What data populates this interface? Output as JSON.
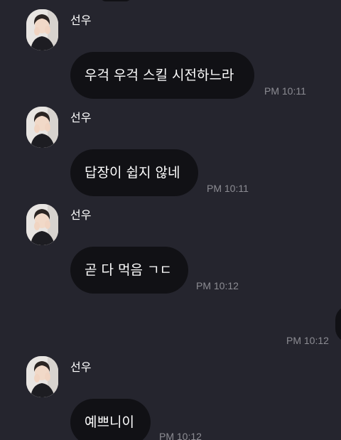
{
  "messages": [
    {
      "sender": "선우",
      "text": "우걱 우걱 스킬 시전하느라",
      "time": "PM 10:11"
    },
    {
      "sender": "선우",
      "text": "답장이 쉽지 않네",
      "time": "PM 10:11"
    },
    {
      "sender": "선우",
      "text": "곧 다 먹음 ㄱㄷ",
      "time": "PM 10:12"
    },
    {
      "sender": "선우",
      "text": "예쁘니이",
      "time": "PM 10:12"
    }
  ],
  "outgoing": {
    "time": "PM 10:12"
  },
  "colors": {
    "background": "#25252e",
    "bubble": "#111115",
    "text": "#ffffff",
    "timestamp": "#8c8c93"
  }
}
